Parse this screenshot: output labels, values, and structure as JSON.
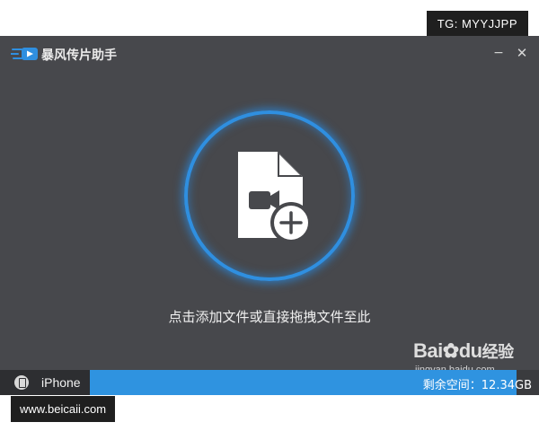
{
  "overlay": {
    "tg_label": "TG: MYYJJPP",
    "site_label": "www.beicaii.com"
  },
  "window": {
    "title": "暴风传片助手",
    "minimize_symbol": "−",
    "close_symbol": "✕"
  },
  "drop_zone": {
    "icon": "video-file-add-icon",
    "hint": "点击添加文件或直接拖拽文件至此",
    "accent_color": "#2f8fe0"
  },
  "watermark": {
    "brand_latin": "Bai",
    "brand_du": "du",
    "brand_cn": "经验",
    "url": "jingyan.baidu.com"
  },
  "status_bar": {
    "device_name": "iPhone",
    "storage_text": "剩余空间：12.34GB",
    "storage_fill_fraction": 0.95,
    "fill_color": "#2f93e0"
  }
}
